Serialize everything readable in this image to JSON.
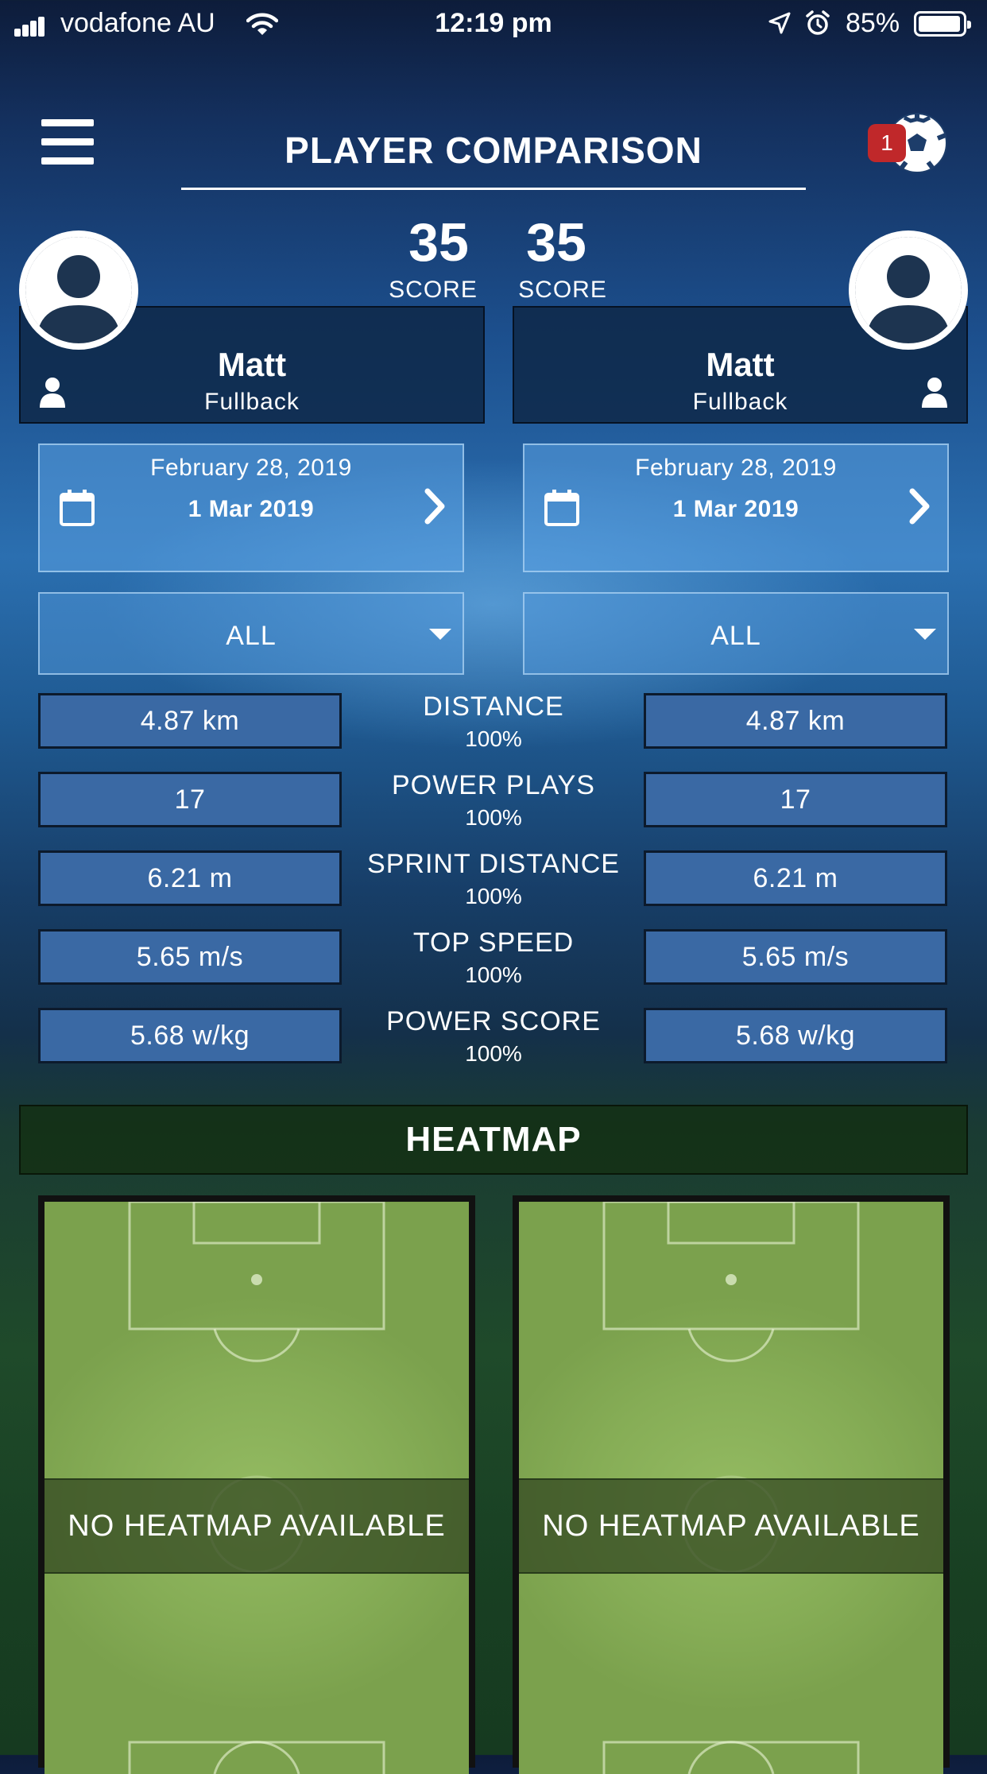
{
  "status_bar": {
    "carrier": "vodafone AU",
    "time": "12:19 pm",
    "battery_percent": "85%",
    "battery_level": 0.85,
    "icons": [
      "signal-icon",
      "wifi-icon",
      "location-icon",
      "alarm-icon",
      "battery-icon"
    ]
  },
  "header": {
    "title": "PLAYER COMPARISON",
    "notification_count": "1",
    "menu_icon": "hamburger-menu-icon",
    "ball_icon": "soccer-ball-icon"
  },
  "players": [
    {
      "score": "35",
      "score_label": "SCORE",
      "name": "Matt",
      "position": "Fullback",
      "date_from": "February 28, 2019",
      "date_to": "1 Mar 2019",
      "filter": "ALL"
    },
    {
      "score": "35",
      "score_label": "SCORE",
      "name": "Matt",
      "position": "Fullback",
      "date_from": "February 28, 2019",
      "date_to": "1 Mar 2019",
      "filter": "ALL"
    }
  ],
  "stats": [
    {
      "label": "DISTANCE",
      "pct": "100%",
      "left": "4.87 km",
      "right": "4.87 km"
    },
    {
      "label": "POWER PLAYS",
      "pct": "100%",
      "left": "17",
      "right": "17"
    },
    {
      "label": "SPRINT DISTANCE",
      "pct": "100%",
      "left": "6.21 m",
      "right": "6.21 m"
    },
    {
      "label": "TOP SPEED",
      "pct": "100%",
      "left": "5.65 m/s",
      "right": "5.65 m/s"
    },
    {
      "label": "POWER SCORE",
      "pct": "100%",
      "left": "5.68 w/kg",
      "right": "5.68 w/kg"
    }
  ],
  "heatmap": {
    "title": "HEATMAP",
    "left_message": "NO HEATMAP AVAILABLE",
    "right_message": "NO HEATMAP AVAILABLE"
  },
  "colors": {
    "badge": "#c0282a",
    "stat_box": "#3a69a4",
    "pitch_green": "#86ad56"
  }
}
